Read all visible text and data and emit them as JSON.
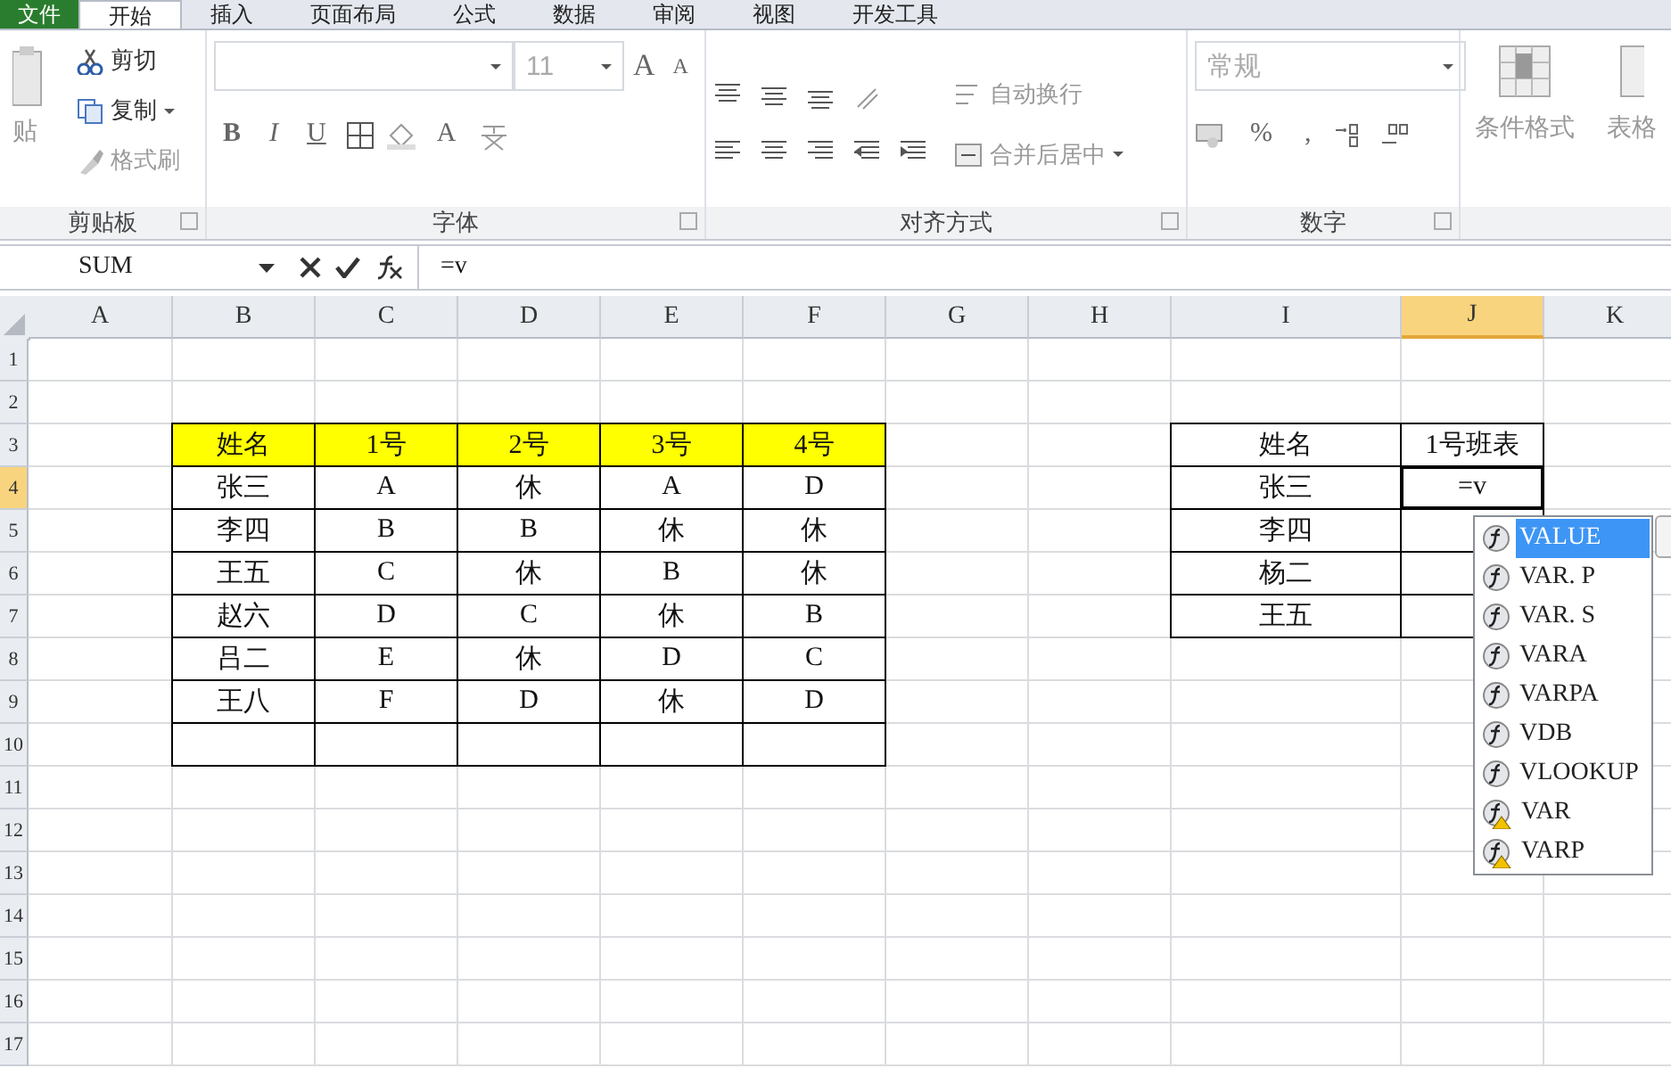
{
  "tabs": [
    {
      "label": "文件",
      "kind": "file",
      "selected": false
    },
    {
      "label": "开始",
      "kind": "tab",
      "selected": true
    },
    {
      "label": "插入",
      "kind": "tab",
      "selected": false
    },
    {
      "label": "页面布局",
      "kind": "tab",
      "selected": false
    },
    {
      "label": "公式",
      "kind": "tab",
      "selected": false
    },
    {
      "label": "数据",
      "kind": "tab",
      "selected": false
    },
    {
      "label": "审阅",
      "kind": "tab",
      "selected": false
    },
    {
      "label": "视图",
      "kind": "tab",
      "selected": false
    },
    {
      "label": "开发工具",
      "kind": "tab",
      "selected": false
    }
  ],
  "ribbon": {
    "groups": [
      {
        "kind": "clipboard",
        "label": "剪贴板",
        "paste_label": "贴",
        "buttons": [
          "剪切",
          "复制",
          "格式刷"
        ]
      },
      {
        "kind": "font",
        "label": "字体",
        "font_size": "11",
        "grow_label": "A",
        "shrink_label": "A",
        "style_buttons": [
          "B",
          "I",
          "U"
        ],
        "font_color_label": "A"
      },
      {
        "kind": "alignment",
        "label": "对齐方式",
        "wrap_label": "自动换行",
        "merge_label": "合并后居中"
      },
      {
        "kind": "number",
        "label": "数字",
        "format": "常规",
        "percent": "%",
        "comma": ","
      },
      {
        "kind": "styles",
        "conditional_label": "条件格式",
        "table_label": "表格"
      }
    ]
  },
  "formula_bar": {
    "name_box": "SUM",
    "formula": "=v"
  },
  "sheet": {
    "columns": [
      {
        "label": "A",
        "selected": false
      },
      {
        "label": "B",
        "selected": false
      },
      {
        "label": "C",
        "selected": false
      },
      {
        "label": "D",
        "selected": false
      },
      {
        "label": "E",
        "selected": false
      },
      {
        "label": "F",
        "selected": false
      },
      {
        "label": "G",
        "selected": false
      },
      {
        "label": "H",
        "selected": false
      },
      {
        "label": "I",
        "selected": false
      },
      {
        "label": "J",
        "selected": true
      },
      {
        "label": "K",
        "selected": false
      }
    ],
    "rows": [
      {
        "label": "1",
        "selected": false
      },
      {
        "label": "2",
        "selected": false
      },
      {
        "label": "3",
        "selected": false
      },
      {
        "label": "4",
        "selected": true
      },
      {
        "label": "5",
        "selected": false
      },
      {
        "label": "6",
        "selected": false
      },
      {
        "label": "7",
        "selected": false
      },
      {
        "label": "8",
        "selected": false
      },
      {
        "label": "9",
        "selected": false
      },
      {
        "label": "10",
        "selected": false
      },
      {
        "label": "11",
        "selected": false
      },
      {
        "label": "12",
        "selected": false
      },
      {
        "label": "13",
        "selected": false
      },
      {
        "label": "14",
        "selected": false
      },
      {
        "label": "15",
        "selected": false
      },
      {
        "label": "16",
        "selected": false
      },
      {
        "label": "17",
        "selected": false
      }
    ]
  },
  "schedule_table": {
    "header": [
      "姓名",
      "1号",
      "2号",
      "3号",
      "4号"
    ],
    "rows": [
      [
        "张三",
        "A",
        "休",
        "A",
        "D"
      ],
      [
        "李四",
        "B",
        "B",
        "休",
        "休"
      ],
      [
        "王五",
        "C",
        "休",
        "B",
        "休"
      ],
      [
        "赵六",
        "D",
        "C",
        "休",
        "B"
      ],
      [
        "吕二",
        "E",
        "休",
        "D",
        "C"
      ],
      [
        "王八",
        "F",
        "D",
        "休",
        "D"
      ]
    ]
  },
  "lookup_table": {
    "header": [
      "姓名",
      "1号班表"
    ],
    "rows": [
      {
        "name": "张三",
        "value": "=v",
        "active": true
      },
      {
        "name": "李四",
        "active": false
      },
      {
        "name": "杨二",
        "active": false
      },
      {
        "name": "王五",
        "active": false
      }
    ]
  },
  "autocomplete": {
    "items": [
      {
        "label": "VALUE",
        "kind": "function",
        "selected": true
      },
      {
        "label": "VAR. P",
        "kind": "function",
        "selected": false
      },
      {
        "label": "VAR. S",
        "kind": "function",
        "selected": false
      },
      {
        "label": "VARA",
        "kind": "function",
        "selected": false
      },
      {
        "label": "VARPA",
        "kind": "function",
        "selected": false
      },
      {
        "label": "VDB",
        "kind": "function",
        "selected": false
      },
      {
        "label": "VLOOKUP",
        "kind": "function",
        "selected": false
      },
      {
        "label": "VAR",
        "kind": "compatibility",
        "selected": false
      },
      {
        "label": "VARP",
        "kind": "compatibility",
        "selected": false
      }
    ]
  }
}
